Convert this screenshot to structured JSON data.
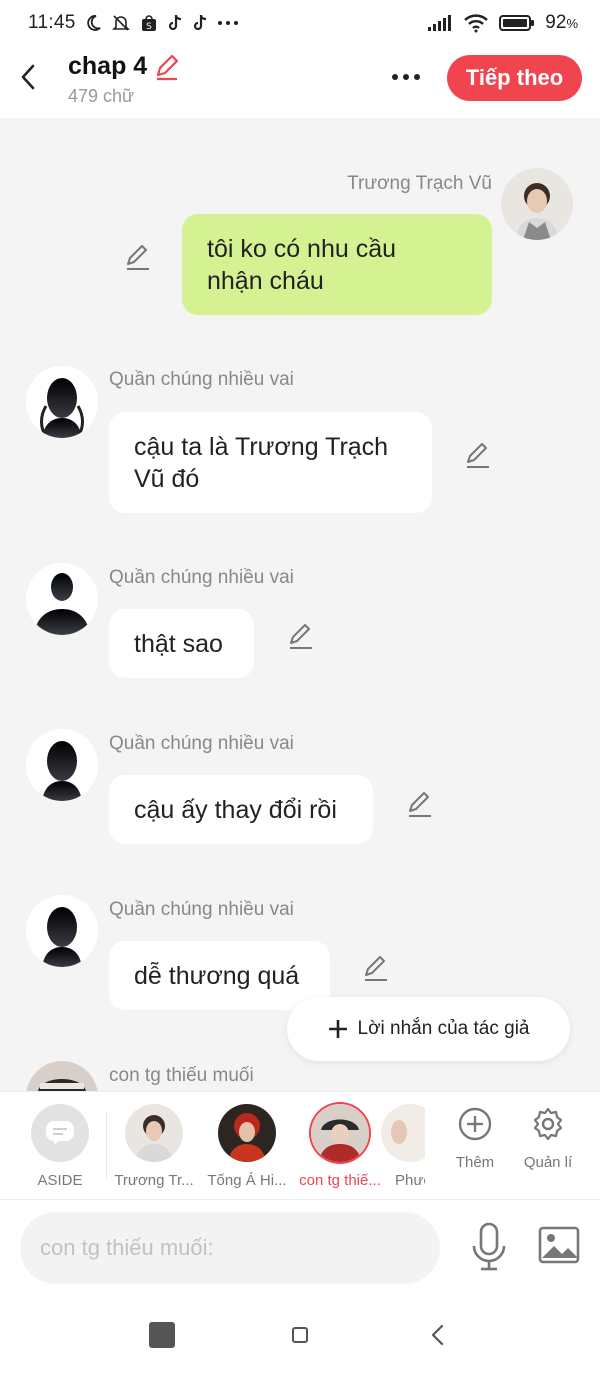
{
  "status_bar": {
    "time": "11:45",
    "battery": "92",
    "battery_unit": "%"
  },
  "header": {
    "title": "chap 4",
    "subtitle": "479 chữ",
    "next_label": "Tiếp theo",
    "accent_color": "#f0454f"
  },
  "messages": [
    {
      "speaker": "Trương Trạch Vũ",
      "text_lines": [
        "tôi ko có nhu cầu",
        "nhận cháu"
      ],
      "side": "right",
      "bubble_color": "#d5f292"
    },
    {
      "speaker": "Quần chúng nhiều vai",
      "text_lines": [
        "cậu ta là  Trương Trạch",
        "Vũ đó"
      ],
      "side": "left"
    },
    {
      "speaker": "Quần chúng nhiều vai",
      "text_lines": [
        "thật sao"
      ],
      "side": "left"
    },
    {
      "speaker": "Quần chúng nhiều vai",
      "text_lines": [
        "cậu ấy thay đổi rồi"
      ],
      "side": "left"
    },
    {
      "speaker": "Quần chúng nhiều vai",
      "text_lines": [
        "dễ thương quá"
      ],
      "side": "left"
    },
    {
      "speaker": "con tg thiếu muối",
      "text_lines": [],
      "side": "left"
    }
  ],
  "author_note_label": "Lời nhắn của tác giả",
  "characters": [
    {
      "label": "ASIDE"
    },
    {
      "label": "Trương Tr..."
    },
    {
      "label": "Tống Á Hi..."
    },
    {
      "label": "con tg thiế...",
      "active": true
    },
    {
      "label": "Phươ"
    }
  ],
  "actions": {
    "more_label": "Thêm",
    "manage_label": "Quản lí"
  },
  "input": {
    "placeholder": "con tg thiếu muối:",
    "value": ""
  }
}
